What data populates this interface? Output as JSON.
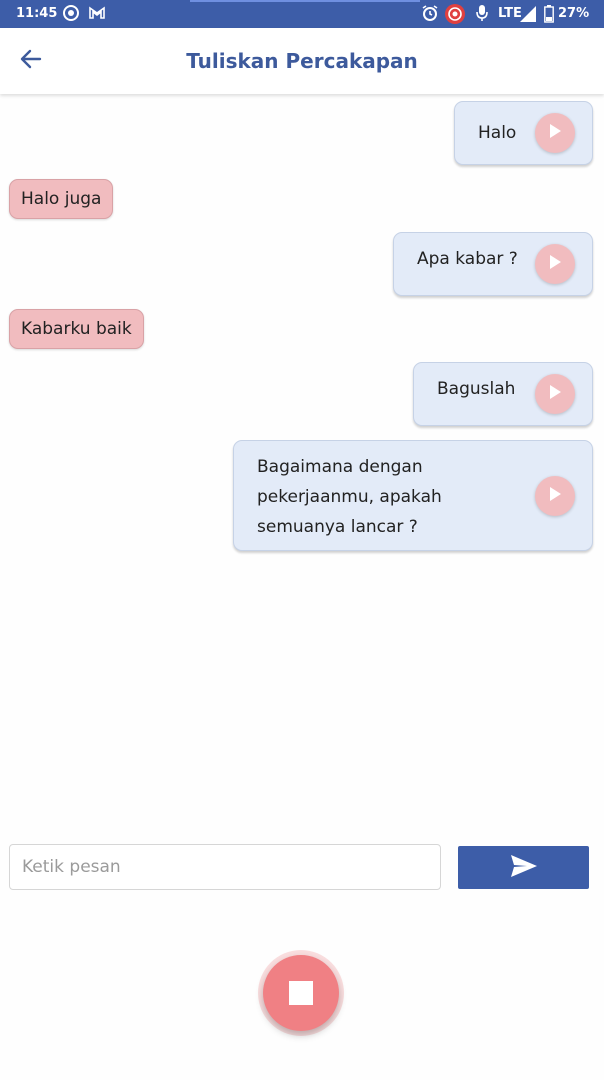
{
  "status_bar": {
    "time": "11:45",
    "network": "LTE",
    "battery": "27%",
    "icons": [
      "radio-icon",
      "gmail-icon",
      "alarm-icon",
      "record-icon",
      "mic-icon",
      "signal-icon",
      "battery-icon"
    ]
  },
  "header": {
    "title": "Tuliskan Percakapan",
    "back_icon": "arrow-left-icon"
  },
  "messages": [
    {
      "sender": "me",
      "text": "Halo"
    },
    {
      "sender": "other",
      "text": "Halo juga"
    },
    {
      "sender": "me",
      "text": "Apa kabar ?"
    },
    {
      "sender": "other",
      "text": "Kabarku baik"
    },
    {
      "sender": "me",
      "text": "Baguslah"
    },
    {
      "sender": "me",
      "text_lines": [
        "Bagaimana dengan",
        "pekerjaanmu, apakah",
        "semuanya lancar ?"
      ]
    }
  ],
  "composer": {
    "placeholder": "Ketik pesan",
    "value": "",
    "send_icon": "send-icon"
  },
  "record": {
    "stop_icon": "stop-icon"
  },
  "colors": {
    "primary": "#3d5da8",
    "title": "#3d5a9c",
    "sent_bubble": "#e3ebf8",
    "received_bubble": "#f1bcbf",
    "stop_button": "#f08084"
  }
}
